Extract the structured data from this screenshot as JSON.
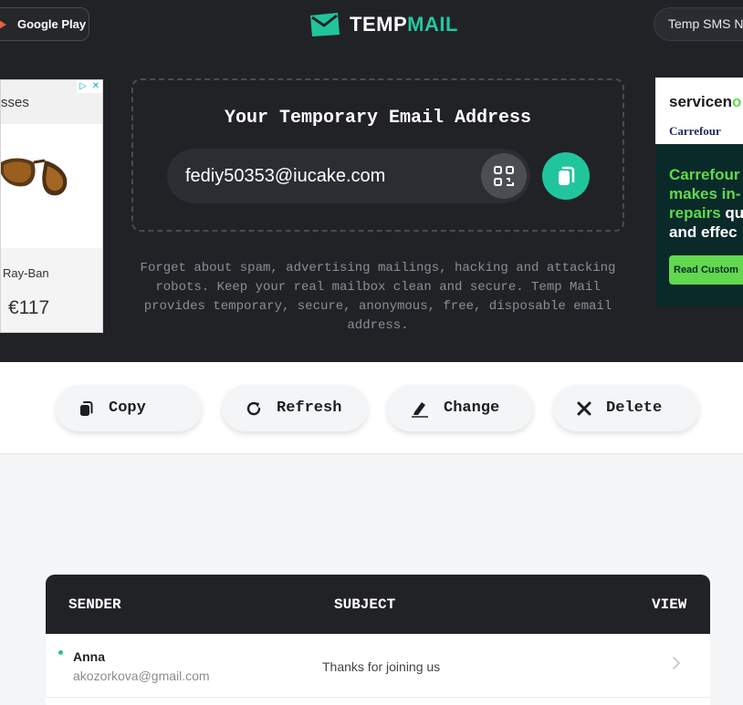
{
  "header": {
    "google_play_label": "Google Play",
    "logo_part1": "TEMP",
    "logo_part2": "MAIL",
    "sms_label": "Temp SMS Nu",
    "accent_color": "#20c59d"
  },
  "ad_left": {
    "heading_partial": "sses",
    "brand": "Ray-Ban",
    "price": "€117"
  },
  "ad_right": {
    "brand_part1": "servicen",
    "brand_part2": "o",
    "sponsor": "Carrefour",
    "line1": "Carrefour",
    "line2": "makes in-",
    "line3_green": "repairs",
    "line3_rest": " qu",
    "line4": "and effec",
    "cta": "Read Custom"
  },
  "email": {
    "title": "Your Temporary Email Address",
    "address": "fediy50353@iucake.com",
    "description": "Forget about spam, advertising mailings, hacking and attacking robots. Keep your real mailbox clean and secure. Temp Mail provides temporary, secure, anonymous, free, disposable email address."
  },
  "actions": {
    "copy": "Copy",
    "refresh": "Refresh",
    "change": "Change",
    "delete": "Delete"
  },
  "inbox": {
    "columns": {
      "sender": "SENDER",
      "subject": "SUBJECT",
      "view": "VIEW"
    },
    "messages": [
      {
        "sender_name": "Anna",
        "sender_email": "akozorkova@gmail.com",
        "subject": "Thanks for joining us",
        "unread": true
      }
    ]
  }
}
